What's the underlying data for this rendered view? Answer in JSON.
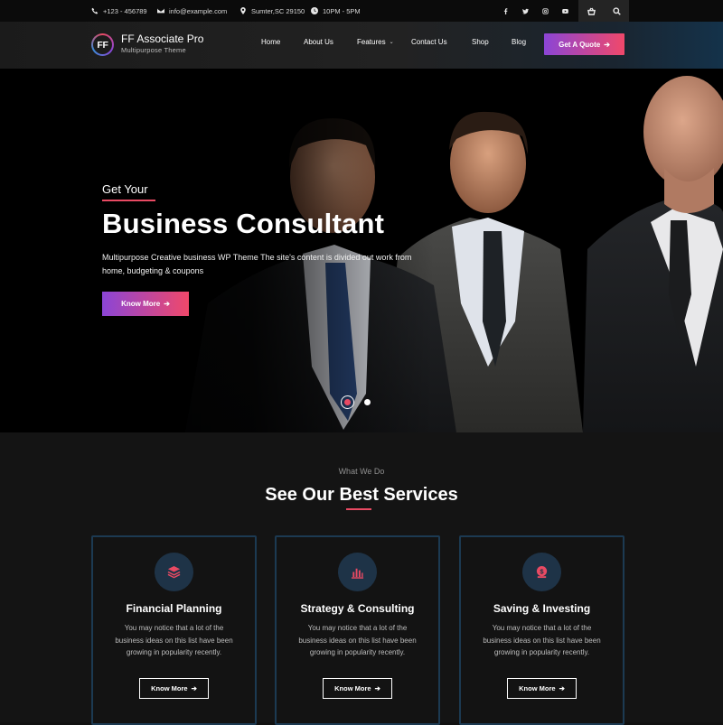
{
  "topbar": {
    "phone": "+123 - 456789",
    "email": "info@example.com",
    "address": "Sumter,SC 29150",
    "hours": "10PM - 5PM",
    "social_icons": [
      "facebook-icon",
      "twitter-icon",
      "instagram-icon",
      "youtube-icon"
    ],
    "cart_icon": "basket-icon",
    "search_icon": "search-icon"
  },
  "header": {
    "logo_initials": "FF",
    "site_title": "FF Associate Pro",
    "tagline": "Multipurpose Theme",
    "nav": [
      "Home",
      "About Us",
      "Features",
      "Contact Us",
      "Shop",
      "Blog"
    ],
    "cta": "Get A Quote"
  },
  "hero": {
    "kicker": "Get Your",
    "title": "Business Consultant",
    "text": "Multipurpose Creative business WP Theme The site's content is divided out work from home, budgeting & coupons",
    "button": "Know More",
    "slides": 2,
    "active_slide": 1
  },
  "services": {
    "kicker": "What We Do",
    "title": "See Our Best Services",
    "cards": [
      {
        "icon": "layers-icon",
        "title": "Financial Planning",
        "text": "You may notice that a lot of the business ideas on this list have been growing in popularity recently.",
        "button": "Know More"
      },
      {
        "icon": "bar-chart-icon",
        "title": "Strategy & Consulting",
        "text": "You may notice that a lot of the business ideas on this list have been growing in popularity recently.",
        "button": "Know More"
      },
      {
        "icon": "money-bag-icon",
        "title": "Saving & Investing",
        "text": "You may notice that a lot of the business ideas on this list have been growing in popularity recently.",
        "button": "Know More"
      }
    ]
  },
  "colors": {
    "accent": "#e94a63",
    "gradient_start": "#8b45d6",
    "gradient_end": "#f0486a",
    "card_border": "#1c3a52",
    "icon_circle": "#1e3347"
  }
}
